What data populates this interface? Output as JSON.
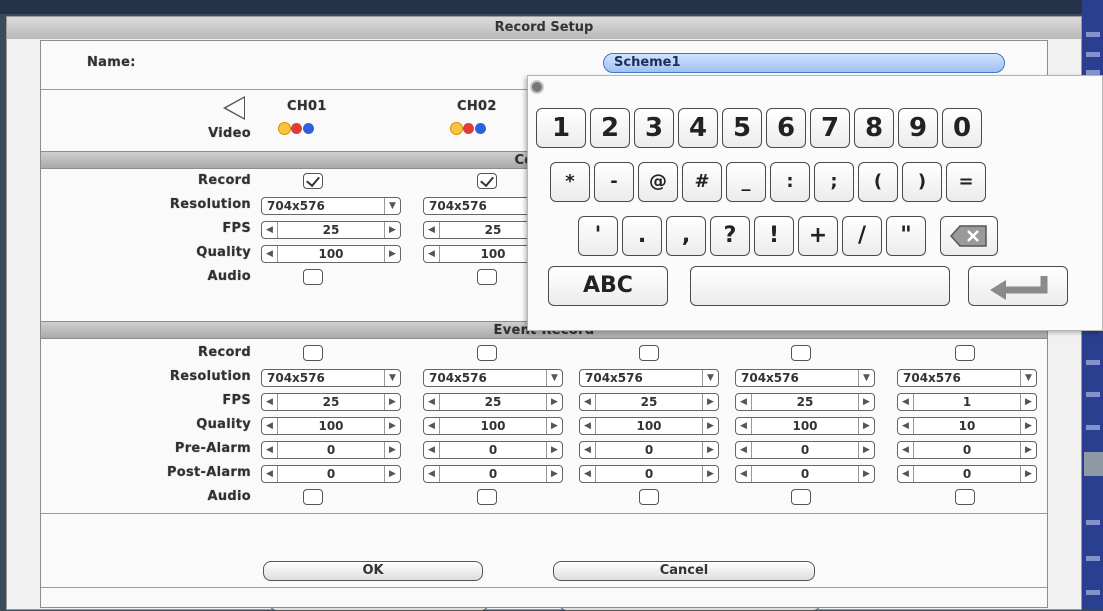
{
  "window": {
    "title": "Record Setup"
  },
  "name_label": "Name:",
  "name_value": "Scheme1",
  "video_label": "Video",
  "channels": [
    "CH01",
    "CH02"
  ],
  "sections": {
    "continuous": "Continu",
    "event": "Event Record"
  },
  "rows": {
    "record": "Record",
    "resolution": "Resolution",
    "fps": "FPS",
    "quality": "Quality",
    "audio": "Audio",
    "pre_alarm": "Pre-Alarm",
    "post_alarm": "Post-Alarm"
  },
  "continuous": {
    "record": [
      true,
      true
    ],
    "resolution": [
      "704x576",
      "704x576"
    ],
    "fps": [
      "25",
      "25"
    ],
    "quality": [
      "100",
      "100"
    ],
    "audio": [
      false,
      false
    ]
  },
  "event": {
    "record": [
      false,
      false,
      false,
      false,
      false
    ],
    "resolution": [
      "704x576",
      "704x576",
      "704x576",
      "704x576",
      "704x576"
    ],
    "fps": [
      "25",
      "25",
      "25",
      "25",
      "1"
    ],
    "quality": [
      "100",
      "100",
      "100",
      "100",
      "10"
    ],
    "pre_alarm": [
      "0",
      "0",
      "0",
      "0",
      "0"
    ],
    "post_alarm": [
      "0",
      "0",
      "0",
      "0",
      "0"
    ],
    "audio": [
      false,
      false,
      false,
      false,
      false
    ]
  },
  "buttons": {
    "ok": "OK",
    "cancel": "Cancel"
  },
  "keyboard": {
    "row1": [
      "1",
      "2",
      "3",
      "4",
      "5",
      "6",
      "7",
      "8",
      "9",
      "0"
    ],
    "row2": [
      "*",
      "-",
      "@",
      "#",
      "_",
      ":",
      ";",
      "(",
      ")",
      "="
    ],
    "row3": [
      "'",
      ".",
      ",",
      "?",
      "!",
      "+",
      "/",
      "\""
    ],
    "mode": "ABC",
    "space": "",
    "backspace_icon": "backspace-icon",
    "enter_icon": "enter-arrow-icon"
  },
  "colors": {
    "accent": "#9fc1f0",
    "header_gray": "#b8b8b8"
  }
}
